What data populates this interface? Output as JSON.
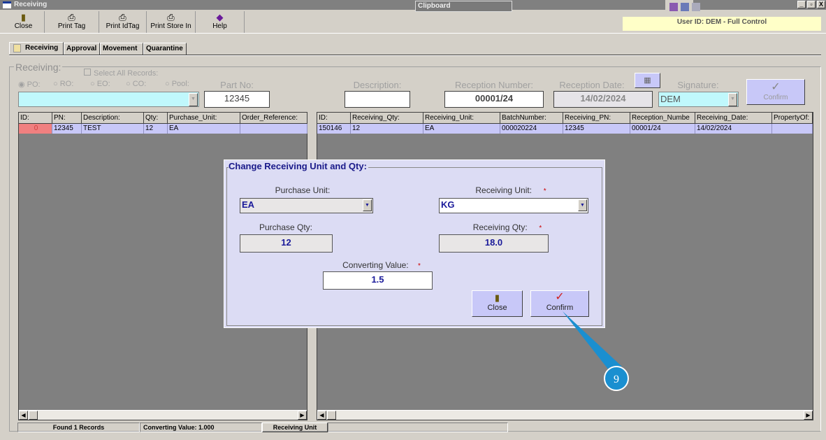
{
  "window": {
    "title": "Receiving",
    "clipboard": "Clipboard",
    "min": "_",
    "restore": "▫",
    "close": "X"
  },
  "toolbar": {
    "close": "Close",
    "print_tag": "Print Tag",
    "print_idtag": "Print IdTag",
    "print_store_in": "Print Store In",
    "help": "Help"
  },
  "user": "User ID: DEM - Full Control",
  "tabs": [
    "Receiving",
    "Approval",
    "Movement",
    "Quarantine"
  ],
  "form": {
    "group_label": "Receiving:",
    "select_all": "Select All Records:",
    "radios": [
      "PO:",
      "RO:",
      "EO:",
      "CO:",
      "Pool:"
    ],
    "part_no_label": "Part No:",
    "part_no": "12345",
    "description_label": "Description:",
    "description": "",
    "reception_number_label": "Reception Number:",
    "reception_number": "00001/24",
    "reception_date_label": "Reception Date:",
    "reception_date": "14/02/2024",
    "signature_label": "Signature:",
    "signature": "DEM",
    "confirm": "Confirm"
  },
  "left_grid": {
    "headers": [
      "ID:",
      "PN:",
      "Description:",
      "Qty:",
      "Purchase_Unit:",
      "Order_Reference:"
    ],
    "row": [
      "0",
      "12345",
      "TEST",
      "12",
      "EA",
      ""
    ]
  },
  "right_grid": {
    "headers": [
      "ID:",
      "Receiving_Qty:",
      "Receiving_Unit:",
      "BatchNumber:",
      "Receiving_PN:",
      "Reception_Numbe",
      "Receiving_Date:",
      "PropertyOf:"
    ],
    "row": [
      "150146",
      "12",
      "EA",
      "000020224",
      "12345",
      "00001/24",
      "14/02/2024",
      ""
    ]
  },
  "status": {
    "found": "Found 1 Records",
    "converting": "Converting Value: 1.000",
    "unit": "Receiving Unit",
    "extra": ""
  },
  "dialog": {
    "title": "Change Receiving Unit and Qty:",
    "purchase_unit_label": "Purchase Unit:",
    "purchase_unit": "EA",
    "receiving_unit_label": "Receiving Unit:",
    "receiving_unit": "KG",
    "purchase_qty_label": "Purchase Qty:",
    "purchase_qty": "12",
    "receiving_qty_label": "Receiving Qty:",
    "receiving_qty": "18.0",
    "converting_label": "Converting Value:",
    "converting_value": "1.5",
    "required": "*",
    "close": "Close",
    "confirm": "Confirm"
  },
  "callout": {
    "step": "9",
    "color": "#1a8fd0"
  }
}
